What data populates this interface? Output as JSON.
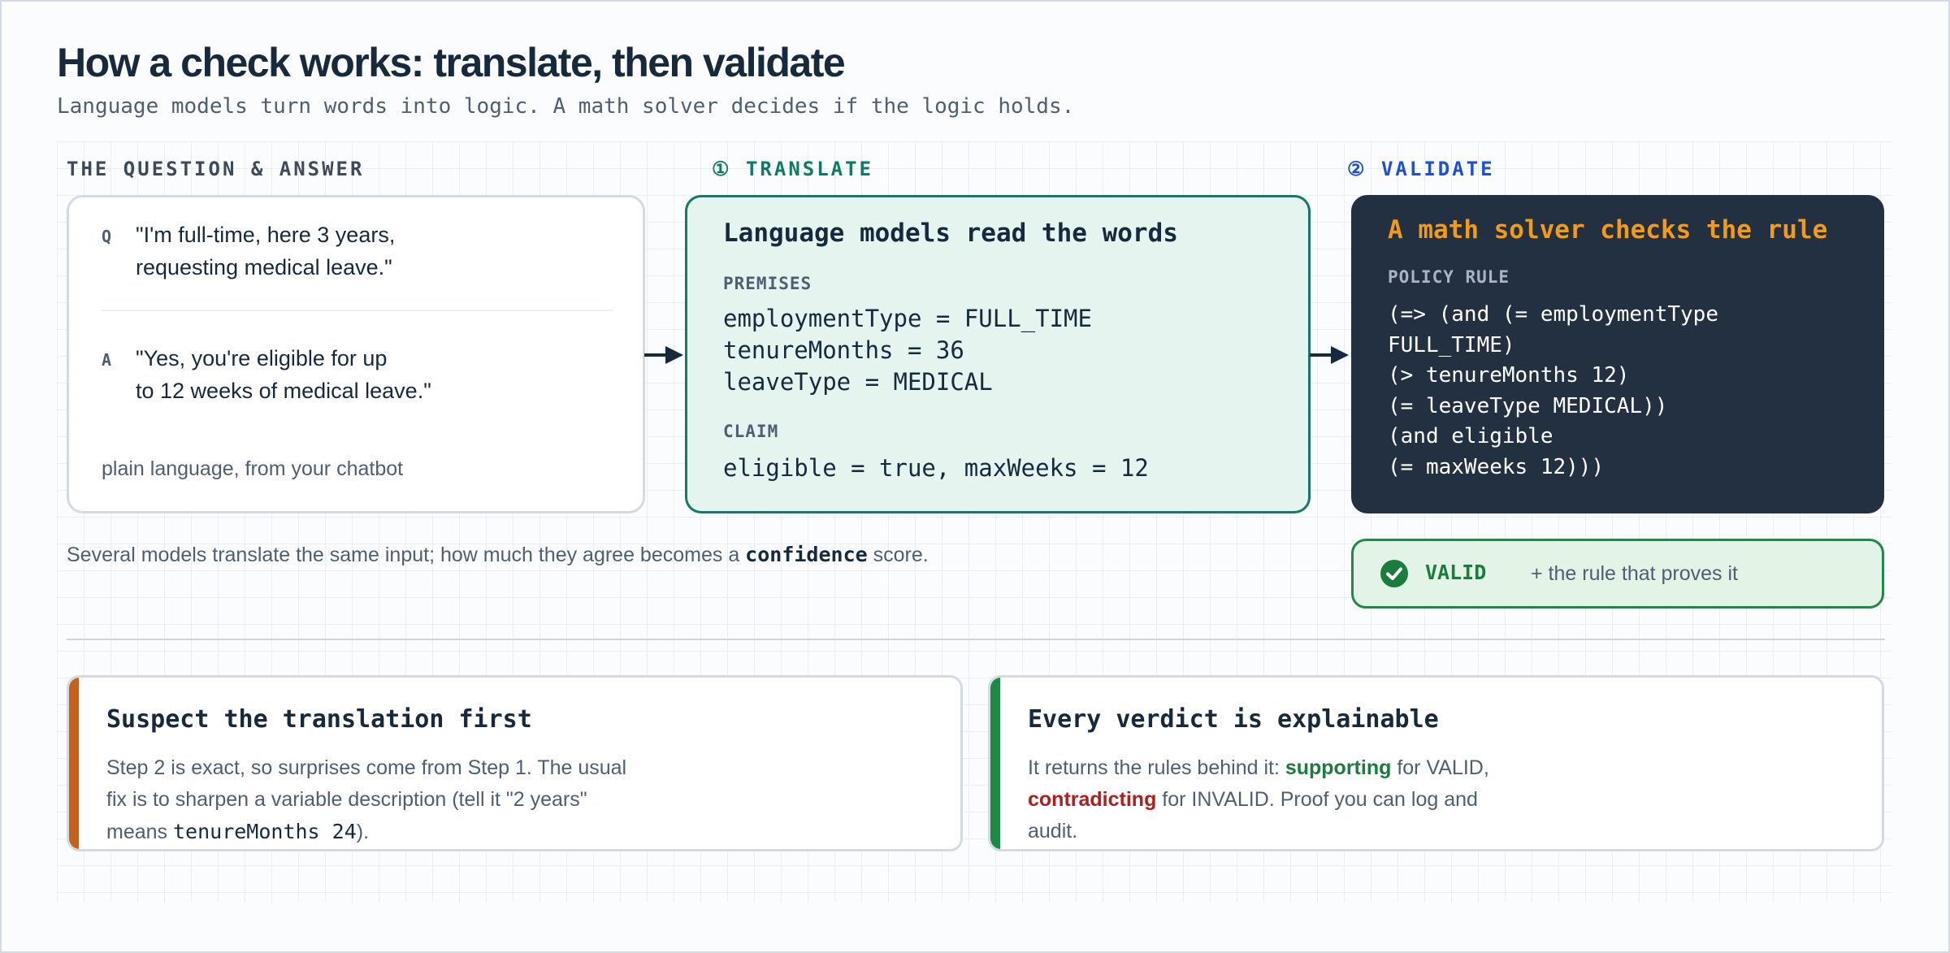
{
  "header": {
    "title": "How a check works: translate, then validate",
    "subtitle": "Language models turn words into logic. A math solver decides if the logic holds."
  },
  "sections": {
    "qa_label": "THE QUESTION & ANSWER",
    "translate_label": "① TRANSLATE",
    "validate_label": "② VALIDATE"
  },
  "qa_card": {
    "q_tag": "Q",
    "question_line1": "\"I'm full-time, here 3 years,",
    "question_line2": "requesting medical leave.\"",
    "a_tag": "A",
    "answer_line1": "\"Yes, you're eligible for up",
    "answer_line2": "to 12 weeks of medical leave.\"",
    "footnote": "plain language, from your chatbot"
  },
  "translate_card": {
    "heading": "Language models read the words",
    "premises_label": "PREMISES",
    "premises": [
      "employmentType = FULL_TIME",
      "tenureMonths = 36",
      "leaveType = MEDICAL"
    ],
    "claim_label": "CLAIM",
    "claim": "eligible = true, maxWeeks = 12"
  },
  "validate_card": {
    "heading": "A math solver checks the rule",
    "rule_label": "POLICY RULE",
    "rule_lines": [
      "(=> (and (= employmentType",
      "FULL_TIME)",
      "(> tenureMonths 12)",
      "(= leaveType MEDICAL))",
      "(and eligible",
      "(= maxWeeks 12)))"
    ]
  },
  "note": {
    "before": "Several models translate the same input; how much they agree becomes a ",
    "keyword": "confidence",
    "after": " score."
  },
  "result": {
    "verdict": "VALID",
    "detail": "+ the rule that proves it"
  },
  "bottom_left": {
    "heading": "Suspect the translation first",
    "line1": "Step 2 is exact, so surprises come from Step 1. The usual",
    "line2": "fix is to sharpen a variable description (tell it \"2 years\"",
    "line3_before": "means ",
    "line3_code": "tenureMonths 24",
    "line3_after": ")."
  },
  "bottom_right": {
    "heading": "Every verdict is explainable",
    "line1_before": "It returns the rules behind it: ",
    "line1_green": "supporting",
    "line1_after": " for VALID,",
    "line2_red": "contradicting",
    "line2_after": " for INVALID. Proof you can log and",
    "line3": "audit."
  },
  "colors": {
    "translate_accent": "#127a69",
    "validate_accent": "#1e4fd6",
    "solver_heading": "#f29a1a",
    "valid_green": "#1a7d3c",
    "warning_orange": "#c4621b",
    "contradict_red": "#b01e1e"
  },
  "icons": {
    "flow_arrow": "arrow-right-icon",
    "valid_check": "check-circle-icon"
  }
}
